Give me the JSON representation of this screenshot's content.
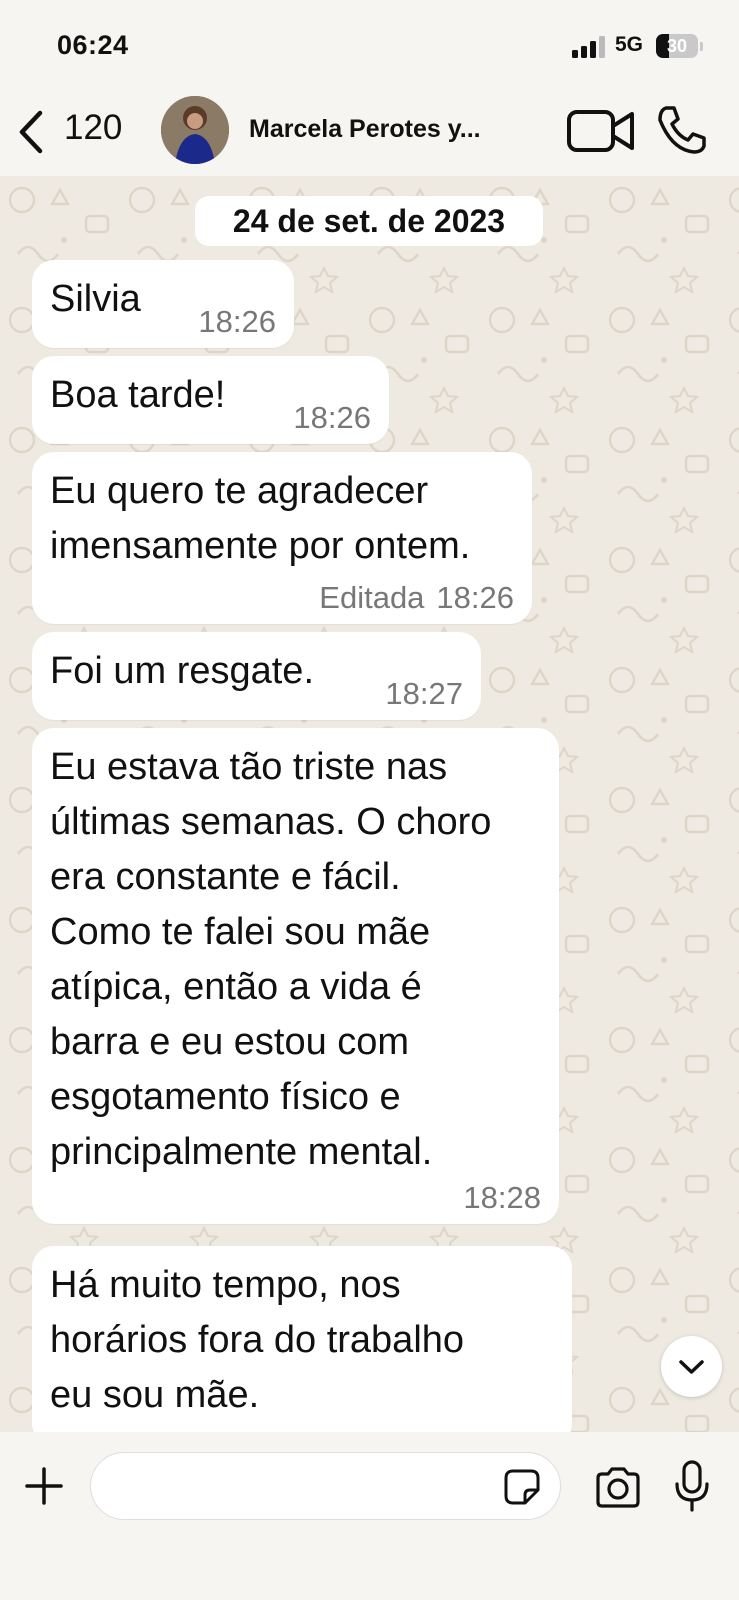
{
  "status_bar": {
    "time": "06:24",
    "network": "5G",
    "battery_level": "30",
    "battery_fraction": 0.3
  },
  "header": {
    "unread_count": "120",
    "contact_name": "Marcela Perotes y...",
    "icons": [
      "chevron-left-icon",
      "avatar",
      "video-call-icon",
      "phone-icon"
    ]
  },
  "chat": {
    "date_separator": "24 de set. de 2023",
    "messages": [
      {
        "lines": [
          "Silvia"
        ],
        "time": "18:26",
        "edited_label": ""
      },
      {
        "lines": [
          "Boa tarde!"
        ],
        "time": "18:26",
        "edited_label": ""
      },
      {
        "lines": [
          "Eu quero te agradecer",
          "imensamente por ontem."
        ],
        "time": "18:26",
        "edited_label": "Editada"
      },
      {
        "lines": [
          "Foi um resgate."
        ],
        "time": "18:27",
        "edited_label": ""
      },
      {
        "lines": [
          "Eu estava tão triste nas",
          "últimas semanas. O choro",
          "era constante e fácil.",
          "Como te falei sou mãe",
          "atípica, então a vida é",
          "barra e eu estou com",
          "esgotamento físico e",
          "principalmente mental."
        ],
        "time": "18:28",
        "edited_label": ""
      },
      {
        "lines": [
          "Há muito tempo, nos",
          "horários fora do trabalho",
          "eu sou mãe."
        ],
        "time": "",
        "edited_label": ""
      }
    ]
  },
  "input_bar": {
    "message_value": "",
    "icons": [
      "plus-icon",
      "sticker-icon",
      "camera-icon",
      "microphone-icon"
    ]
  },
  "colors": {
    "chat_background": "#efeae1",
    "bubble": "#ffffff",
    "timestamp": "#777777",
    "bars": "#f6f5f2"
  }
}
